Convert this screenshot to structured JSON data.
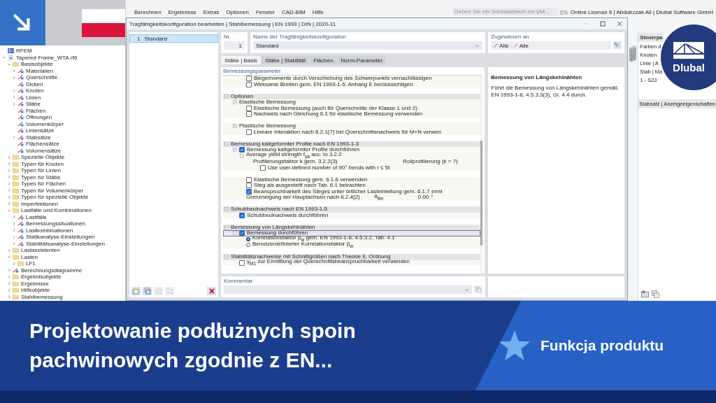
{
  "app": {
    "menu": [
      "Berechnen",
      "Ergebnisse",
      "Extras",
      "Optionen",
      "Fenster",
      "CAD-BIM",
      "Hilfe"
    ],
    "search": {
      "placeholder": "Geben Sie ein Schlüsselwort ein (Alt..."
    },
    "license": "Online License 6 | Abdulrzzak Ali | Dlubal Software GmbH"
  },
  "navigator": {
    "items": [
      {
        "label": "RFEM",
        "kind": "root"
      },
      {
        "label": "Tapered Frame_WTA.rf6",
        "kind": "file",
        "expanded": true,
        "children": [
          {
            "label": "Basisobjekte",
            "kind": "folder",
            "expanded": true,
            "children": [
              {
                "label": "Materialien",
                "kind": "object",
                "expanded": false
              },
              {
                "label": "Querschnitte",
                "kind": "object",
                "expanded": false
              },
              {
                "label": "Dicken",
                "kind": "object"
              },
              {
                "label": "Knoten",
                "kind": "object",
                "expanded": false
              },
              {
                "label": "Linien",
                "kind": "object",
                "expanded": false
              },
              {
                "label": "Stäbe",
                "kind": "object",
                "expanded": false
              },
              {
                "label": "Flächen",
                "kind": "object"
              },
              {
                "label": "Öffnungen",
                "kind": "object"
              },
              {
                "label": "Volumenkörper",
                "kind": "object"
              },
              {
                "label": "Liniensätze",
                "kind": "object"
              },
              {
                "label": "Stabsätze",
                "kind": "object",
                "expanded": false
              },
              {
                "label": "Flächensätze",
                "kind": "object"
              },
              {
                "label": "Volumensätze",
                "kind": "object"
              }
            ]
          },
          {
            "label": "Spezielle Objekte",
            "kind": "folder",
            "expanded": false
          },
          {
            "label": "Typen für Knoten",
            "kind": "folder",
            "expanded": false
          },
          {
            "label": "Typen für Linien",
            "kind": "folder",
            "expanded": false
          },
          {
            "label": "Typen für Stäbe",
            "kind": "folder",
            "expanded": false
          },
          {
            "label": "Typen für Flächen",
            "kind": "folder",
            "expanded": false
          },
          {
            "label": "Typen für Volumenkörper",
            "kind": "folder",
            "expanded": false
          },
          {
            "label": "Typen für spezielle Objekte",
            "kind": "folder",
            "expanded": false
          },
          {
            "label": "Imperfektionen",
            "kind": "folder",
            "expanded": false
          },
          {
            "label": "Lastfälle und Kombinationen",
            "kind": "folder",
            "expanded": true,
            "children": [
              {
                "label": "Lastfälle",
                "kind": "object",
                "expanded": false
              },
              {
                "label": "Bemessungssituationen",
                "kind": "object",
                "expanded": false
              },
              {
                "label": "Lastkombinationen",
                "kind": "object",
                "expanded": false
              },
              {
                "label": "Statikanalyse-Einstellungen",
                "kind": "object",
                "expanded": false
              },
              {
                "label": "Stabilitätsanalyse-Einstellungen",
                "kind": "object",
                "expanded": false
              }
            ]
          },
          {
            "label": "Lastassistenten",
            "kind": "folder",
            "expanded": false
          },
          {
            "label": "Lasten",
            "kind": "folder",
            "expanded": true,
            "children": [
              {
                "label": "LF1",
                "kind": "folder",
                "expanded": false
              }
            ]
          },
          {
            "label": "Berechnungsdiagramme",
            "kind": "object",
            "expanded": false
          },
          {
            "label": "Ergebnisobjekte",
            "kind": "folder",
            "expanded": false
          },
          {
            "label": "Ergebnisse",
            "kind": "folder",
            "expanded": false
          },
          {
            "label": "Hilfsobjekte",
            "kind": "folder",
            "expanded": false
          },
          {
            "label": "Stahlbemessung",
            "kind": "folder",
            "expanded": false
          }
        ]
      }
    ]
  },
  "dialog": {
    "title": "Tragfähigkeitskonfiguration bearbeiten | Stahlbemessung | EN 1993 | DIN | 2020-11",
    "list": [
      {
        "number": "1",
        "name": "Standard",
        "selected": true
      }
    ],
    "number": {
      "label": "Nr.",
      "value": "1"
    },
    "name": {
      "label": "Name der Tragfähigkeitskonfiguration",
      "value": "Standard"
    },
    "assigned": {
      "label": "Zugewiesen an",
      "values": [
        "Alle",
        "Alle"
      ]
    },
    "tabs": [
      {
        "label": "Stäbe | Basis",
        "selected": true
      },
      {
        "label": "Stäbe | Stabilität",
        "selected": false
      },
      {
        "label": "Flächen",
        "selected": false
      },
      {
        "label": "Norm-Parameter",
        "selected": false
      }
    ],
    "parameters": {
      "title": "Bemessungsparameter",
      "sections": [
        {
          "items": [
            {
              "kind": "checkbox",
              "label": "Biegemomente durch Verschiebung des Schwerpunkts vernachlässigen",
              "checked": false,
              "highlighted": false
            },
            {
              "kind": "checkbox",
              "label": "Wirksame Breiten gem. EN 1993-1-5, Anhang E berücksichtigen",
              "checked": false,
              "highlighted": false
            }
          ]
        },
        {
          "title": "Optionen",
          "expanded": true,
          "items": [
            {
              "kind": "group",
              "label": "Elastische Bemessung",
              "expanded": true,
              "highlighted": false,
              "children": [
                {
                  "kind": "checkbox",
                  "label": "Elastische Bemessung (auch für Querschnitte der Klasse 1 und 2)",
                  "checked": false,
                  "highlighted": false
                },
                {
                  "kind": "checkbox",
                  "label": "Nachweis nach Gleichung 6.1 für elastische Bemessung verwenden",
                  "checked": false,
                  "highlighted": false
                }
              ]
            },
            {
              "kind": "group",
              "label": "Plastische Bemessung",
              "expanded": true,
              "highlighted": false,
              "children": [
                {
                  "kind": "checkbox",
                  "label": "Lineare Interaktion nach 6.2.1(7) bei Querschnittsnachweis für M+N verwen",
                  "checked": false,
                  "highlighted": false
                }
              ]
            }
          ]
        },
        {
          "title": "Bemessung kaltgeformter Profile nach EN 1993-1-3",
          "expanded": true,
          "items": [
            {
              "kind": "checkbox",
              "label": "Bemessung kaltgeformter Profile durchführen",
              "checked": true,
              "expanded": true,
              "highlighted": false,
              "children": [
                {
                  "kind": "group",
                  "label": "Average yield strength f$_{ya}$ acc. to 3.2.2",
                  "expanded": true,
                  "highlighted": false,
                  "children": [
                    {
                      "kind": "value",
                      "label": "Profilierungsfaktor k gem. 3.2.2(3)",
                      "value": "Rollprofilierung (k = 7)",
                      "highlighted": false,
                      "children": [
                        {
                          "kind": "checkbox",
                          "label": "Use user-defined number of 90° bends with r ≤ 5t",
                          "checked": false,
                          "highlighted": false
                        }
                      ]
                    }
                  ]
                },
                {
                  "kind": "checkbox",
                  "label": "Elastische Bemessung gem. 6.1.6 verwenden",
                  "checked": false,
                  "highlighted": false
                },
                {
                  "kind": "checkbox",
                  "label": "Steg als ausgesteift nach Tab. 6.1 betrachten",
                  "checked": false,
                  "highlighted": false
                },
                {
                  "kind": "checkbox",
                  "label": "Beanspruchbarkeit des Steges unter örtlicher Lasteinleitung gem. 6.1.7 ermi",
                  "checked": true,
                  "highlighted": false
                },
                {
                  "kind": "value",
                  "label": "Grenzneigung der Hauptachsen nach 6.2.4(2)",
                  "symbol": "θ$_{lim}$",
                  "value": "0.00",
                  "unit": "°",
                  "highlighted": false
                }
              ]
            }
          ]
        },
        {
          "title": "Schubbeulnachweis nach EN 1993-1-5",
          "expanded": true,
          "items": [
            {
              "kind": "checkbox",
              "label": "Schubbeulnachweis durchführen",
              "checked": true,
              "highlighted": false
            }
          ]
        },
        {
          "title": "Bemessung von Längskehlnähten",
          "expanded": true,
          "items": [
            {
              "kind": "checkbox",
              "label": "Bemessung durchführen",
              "checked": true,
              "expanded": true,
              "highlighted": true,
              "children": [
                {
                  "kind": "radio",
                  "label": "Korrelationsfaktor β$_{w}$ gem. EN 1993-1-8, 4.5.3.2, Tab. 4.1",
                  "selected": true,
                  "highlighted": false
                },
                {
                  "kind": "radio",
                  "label": "Benutzerdefinierter Korrelationsfaktor β$_{w}$",
                  "selected": false,
                  "highlighted": false
                }
              ]
            }
          ]
        },
        {
          "title": "Stabilitätsnachweise mit Schnittgrößen nach Theorie II. Ordnung",
          "expanded": true,
          "items": [
            {
              "kind": "checkbox",
              "label": "γ$_{M1}$ zur Ermittlung der Querschnittsbeanspruchbarkeit verwenden",
              "checked": false,
              "highlighted": false
            }
          ]
        }
      ]
    },
    "description": {
      "title": "Bemessung von Längskehlnähten",
      "text": "Führt die Bemessung von Längskehlnähten gemäß EN 1993-1-8, 4.5.3.3(3), Gl. 4.4 durch."
    },
    "comment": {
      "label": "Kommentar"
    }
  },
  "control_panel": {
    "title": "Steuerpa",
    "rows": [
      "Farben d",
      "Knoten",
      "Linie | A",
      "Stab | Ma",
      "1 - S23"
    ],
    "footer": "Stabsatz | Anzeigeeigenschaften"
  },
  "logo": "Dlubal",
  "banner": {
    "title": "Projektowanie podłużnych spoin pachwinowych zgodnie z EN...",
    "badge": "Funkcja produktu"
  }
}
